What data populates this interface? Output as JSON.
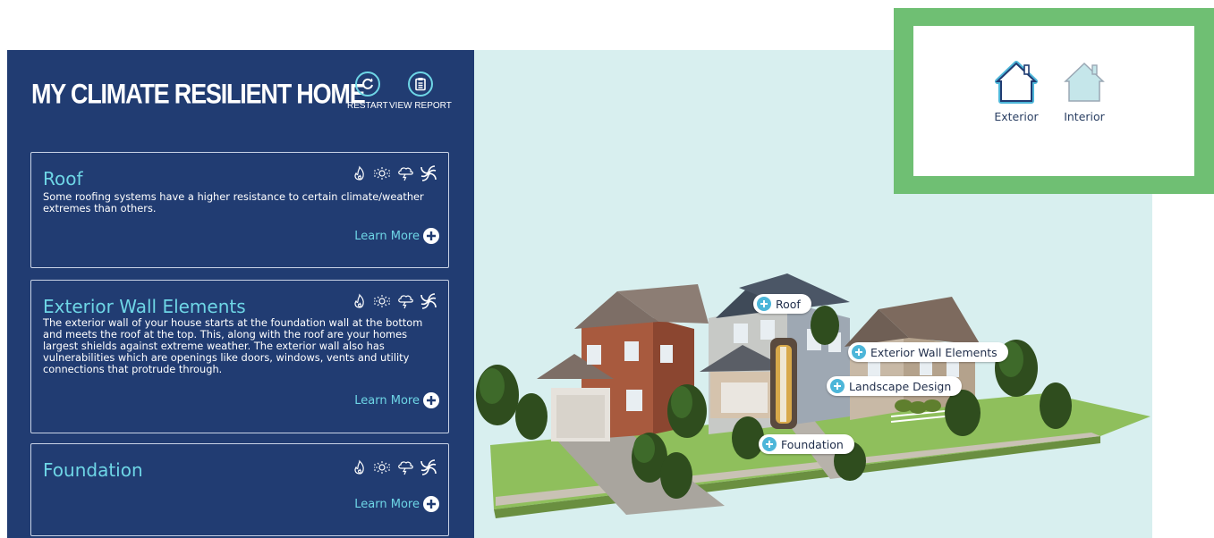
{
  "app": {
    "title": "MY CLIMATE RESILIENT HOME",
    "restart_label": "RESTART",
    "report_label": "VIEW REPORT"
  },
  "cards": [
    {
      "title": "Roof",
      "description": "Some roofing systems have a higher resistance to certain climate/weather extremes than others.",
      "learn_more": "Learn More"
    },
    {
      "title": "Exterior Wall Elements",
      "description": "The exterior wall of your house starts at the foundation wall at the bottom and meets the roof at the top. This, along with the roof are your homes largest shields against extreme weather. The exterior wall also has vulnerabilities which are openings like doors, windows, vents and utility connections that protrude through.",
      "learn_more": "Learn More"
    },
    {
      "title": "Foundation",
      "description": "",
      "learn_more": "Learn More"
    }
  ],
  "hazard_icons": [
    "wildfire-icon",
    "heat-icon",
    "storm-icon",
    "hurricane-icon"
  ],
  "hotspots": {
    "roof": "Roof",
    "exterior_wall": "Exterior Wall Elements",
    "landscape": "Landscape Design",
    "foundation": "Foundation"
  },
  "view_toggle": {
    "exterior": "Exterior",
    "interior": "Interior",
    "selected": "Exterior"
  },
  "colors": {
    "panel": "#213c72",
    "accent": "#6ed6e6",
    "scene_bg": "#d8efef",
    "highlight": "#6fbf73",
    "hotspot_dot": "#4db6d9"
  }
}
